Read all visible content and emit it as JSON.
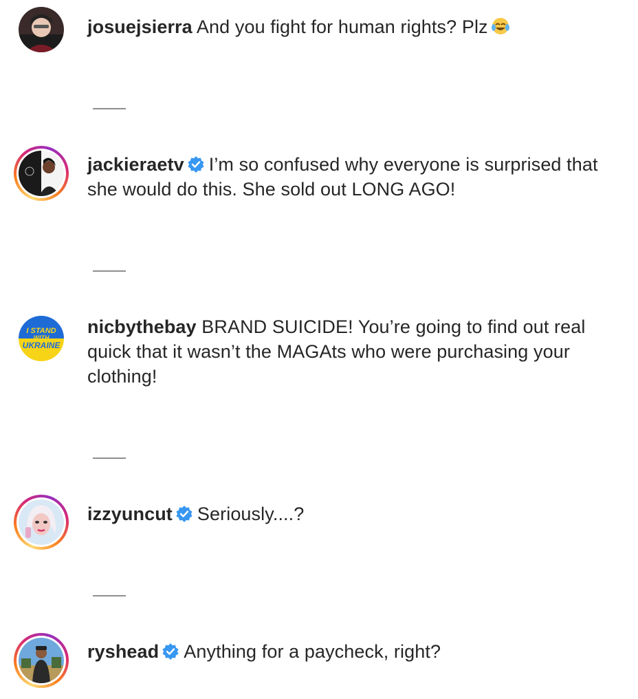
{
  "comments": [
    {
      "username": "josuejsierra",
      "verified": false,
      "text": "And you fight for human rights? Plz",
      "emoji": "face-with-tears-of-joy"
    },
    {
      "username": "jackieraetv",
      "verified": true,
      "text": "I’m so confused why everyone is surprised that she would do this. She sold out LONG AGO!"
    },
    {
      "username": "nicbythebay",
      "verified": false,
      "text": "BRAND SUICIDE! You’re going to find out real quick that it wasn’t the MAGAts who were purchasing your clothing!",
      "avatar_text": [
        "I STAND",
        "WITH",
        "UKRAINE"
      ]
    },
    {
      "username": "izzyuncut",
      "verified": true,
      "text": "Seriously....?"
    },
    {
      "username": "ryshead",
      "verified": true,
      "text": "Anything for a paycheck, right?"
    }
  ],
  "colors": {
    "text": "#262626",
    "verified_badge": "#3897f0",
    "divider": "#8e8e8e",
    "ukraine_blue": "#1e6bd6",
    "ukraine_yellow": "#f7d417"
  }
}
